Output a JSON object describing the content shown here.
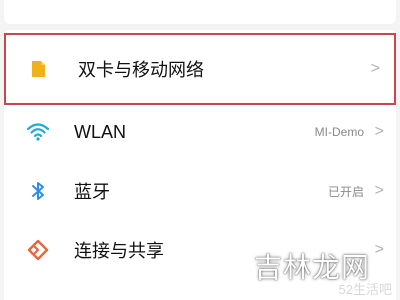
{
  "settings": {
    "items": [
      {
        "icon": "sim-card-icon",
        "label": "双卡与移动网络",
        "value": "",
        "selected": true
      },
      {
        "icon": "wifi-icon",
        "label": "WLAN",
        "value": "MI-Demo",
        "selected": false
      },
      {
        "icon": "bluetooth-icon",
        "label": "蓝牙",
        "value": "已开启",
        "selected": false
      },
      {
        "icon": "connection-share-icon",
        "label": "连接与共享",
        "value": "",
        "selected": false
      }
    ]
  },
  "chevron": ">",
  "watermark": {
    "text": "吉林龙网",
    "subtext": "52生活吧"
  },
  "colors": {
    "background": "#f4f4f4",
    "highlight": "#c9474b",
    "sim": "#f0b21a",
    "wifi": "#1fa8de",
    "bluetooth": "#2f8de8",
    "connect": "#e6673d"
  }
}
